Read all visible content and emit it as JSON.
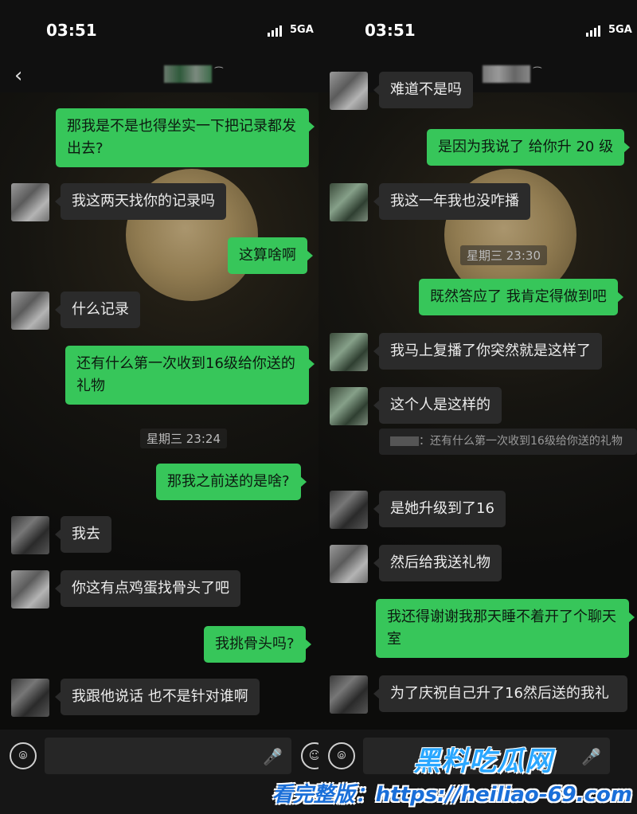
{
  "status": {
    "time": "03:51",
    "network": "5GA"
  },
  "left": {
    "messages": [
      {
        "side": "me",
        "text": "那我是不是也得坐实一下把记录都发出去?"
      },
      {
        "side": "them",
        "text": "我这两天找你的记录吗"
      },
      {
        "side": "me",
        "text": "这算啥啊"
      },
      {
        "side": "them",
        "text": "什么记录"
      },
      {
        "side": "me",
        "text": "还有什么第一次收到16级给你送的礼物"
      },
      {
        "side": "time",
        "text": "星期三 23:24"
      },
      {
        "side": "me",
        "text": "那我之前送的是啥?"
      },
      {
        "side": "them",
        "text": "我去"
      },
      {
        "side": "them",
        "text": "你这有点鸡蛋找骨头了吧"
      },
      {
        "side": "me",
        "text": "我挑骨头吗?"
      },
      {
        "side": "them",
        "text": "我跟他说话 也不是针对谁啊"
      }
    ]
  },
  "right": {
    "messages": [
      {
        "side": "them",
        "text": "难道不是吗"
      },
      {
        "side": "me",
        "text": "是因为我说了 给你升 20 级"
      },
      {
        "side": "them",
        "text": "我这一年我也没咋播"
      },
      {
        "side": "time",
        "text": "星期三 23:30"
      },
      {
        "side": "me",
        "text": "既然答应了 我肯定得做到吧"
      },
      {
        "side": "them",
        "text": "我马上复播了你突然就是这样了"
      },
      {
        "side": "them",
        "text": "这个人是这样的"
      },
      {
        "side": "quote",
        "text": "：还有什么第一次收到16级给你送的礼物"
      },
      {
        "side": "them",
        "text": "是她升级到了16"
      },
      {
        "side": "them",
        "text": "然后给我送礼物"
      },
      {
        "side": "me",
        "text": "我还得谢谢我那天睡不着开了个聊天室"
      },
      {
        "side": "them",
        "text": "为了庆祝自己升了16然后送的我礼"
      }
    ]
  },
  "watermark": {
    "title": "黑料吃瓜网",
    "url": "看完整版：https://heiliao-69.com"
  },
  "colors": {
    "me_bubble": "#37c65a",
    "them_bubble": "#2b2b2b",
    "background": "#0b0b0b"
  }
}
